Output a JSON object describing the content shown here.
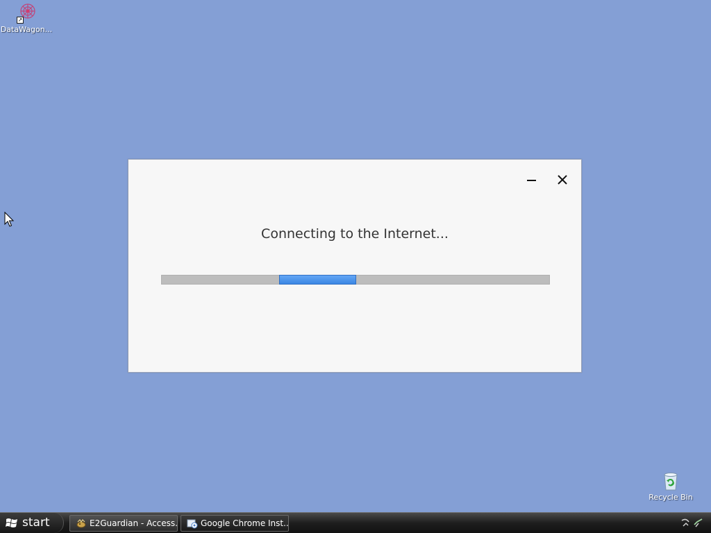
{
  "desktop": {
    "background_color": "#849fd5",
    "icons": [
      {
        "label": "DataWagon...",
        "icon": "datawagon-icon"
      },
      {
        "label": "Recycle Bin",
        "icon": "recycle-bin-icon"
      }
    ]
  },
  "dialog": {
    "status_text": "Connecting to the Internet...",
    "progress_style": "indeterminate-marquee",
    "minimize_icon": "minimize-icon",
    "close_icon": "close-icon",
    "accent_color": "#4a90e2"
  },
  "taskbar": {
    "start_label": "start",
    "tasks": [
      {
        "label": "E2Guardian - Access...",
        "icon": "e2guardian-icon",
        "active": false
      },
      {
        "label": "Google Chrome Inst...",
        "icon": "chrome-installer-icon",
        "active": true
      }
    ],
    "tray_icons": [
      "network-icon",
      "volume-icon"
    ]
  }
}
